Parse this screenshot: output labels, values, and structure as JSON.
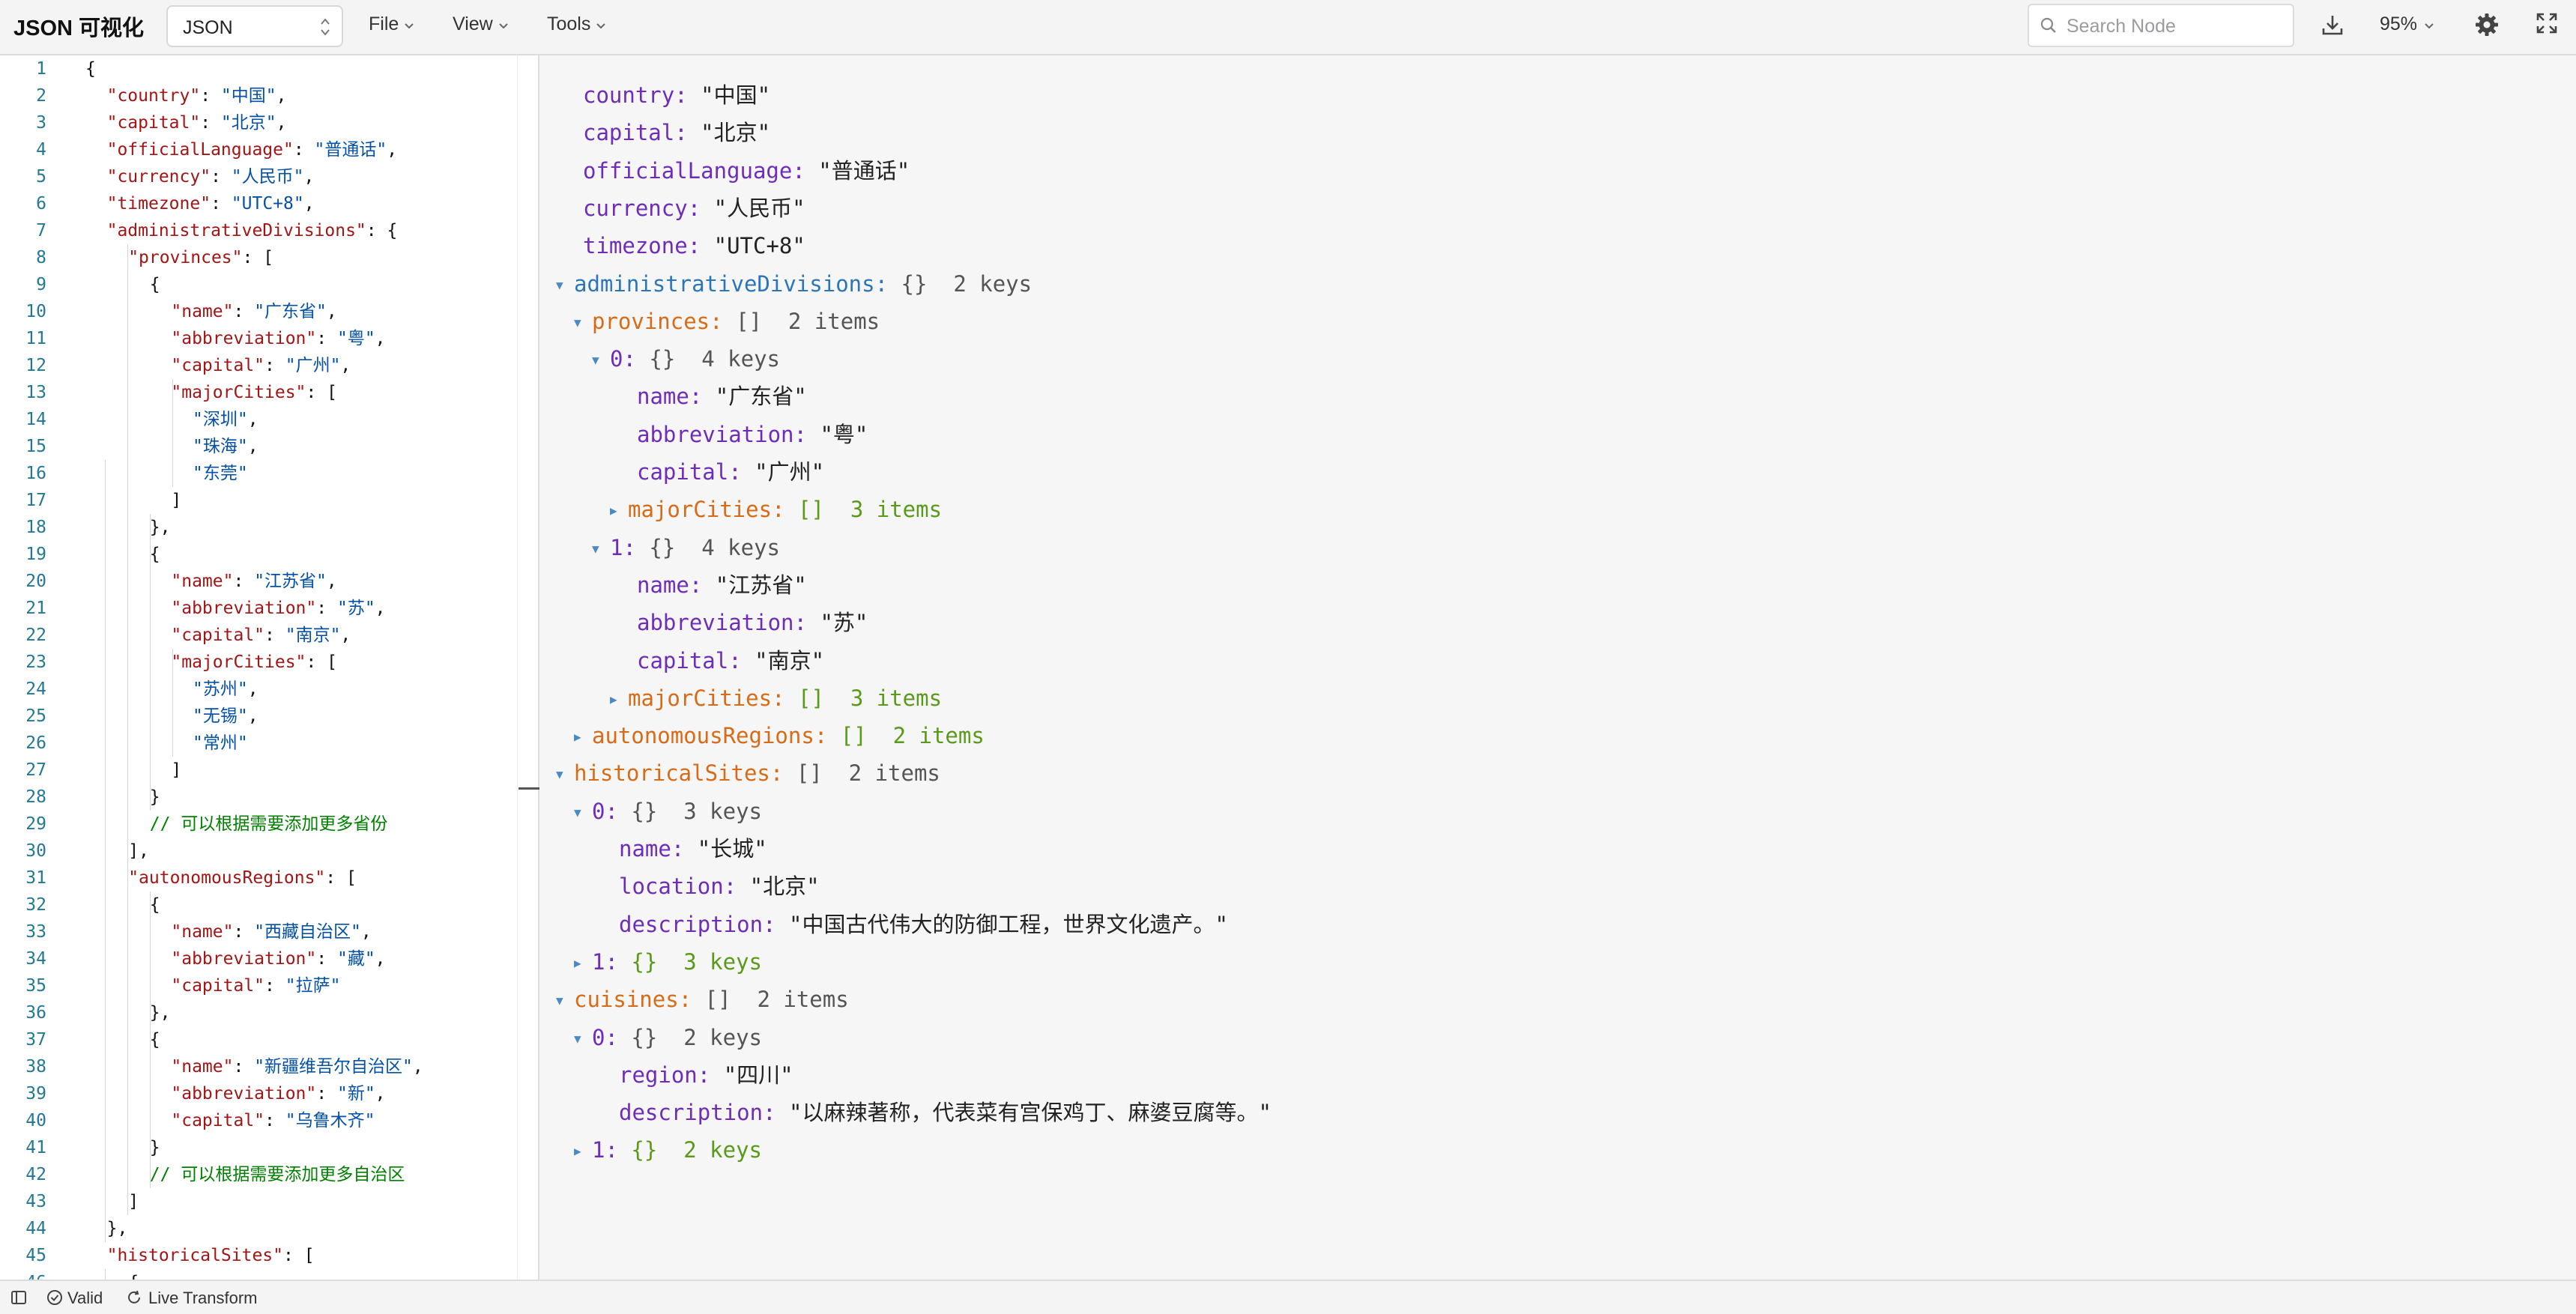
{
  "header": {
    "app_title": "JSON 可视化",
    "format_value": "JSON",
    "menus": [
      "File",
      "View",
      "Tools"
    ],
    "search_placeholder": "Search Node",
    "zoom_label": "95%"
  },
  "editor": {
    "lines": [
      [
        {
          "t": "p",
          "v": "{"
        }
      ],
      [
        {
          "t": "k",
          "v": "\"country\""
        },
        {
          "t": "p",
          "v": ": "
        },
        {
          "t": "s",
          "v": "\"中国\""
        },
        {
          "t": "p",
          "v": ","
        }
      ],
      [
        {
          "t": "k",
          "v": "\"capital\""
        },
        {
          "t": "p",
          "v": ": "
        },
        {
          "t": "s",
          "v": "\"北京\""
        },
        {
          "t": "p",
          "v": ","
        }
      ],
      [
        {
          "t": "k",
          "v": "\"officialLanguage\""
        },
        {
          "t": "p",
          "v": ": "
        },
        {
          "t": "s",
          "v": "\"普通话\""
        },
        {
          "t": "p",
          "v": ","
        }
      ],
      [
        {
          "t": "k",
          "v": "\"currency\""
        },
        {
          "t": "p",
          "v": ": "
        },
        {
          "t": "s",
          "v": "\"人民币\""
        },
        {
          "t": "p",
          "v": ","
        }
      ],
      [
        {
          "t": "k",
          "v": "\"timezone\""
        },
        {
          "t": "p",
          "v": ": "
        },
        {
          "t": "s",
          "v": "\"UTC+8\""
        },
        {
          "t": "p",
          "v": ","
        }
      ],
      [
        {
          "t": "k",
          "v": "\"administrativeDivisions\""
        },
        {
          "t": "p",
          "v": ": {"
        }
      ],
      [
        {
          "t": "k",
          "v": "\"provinces\""
        },
        {
          "t": "p",
          "v": ": ["
        }
      ],
      [
        {
          "t": "p",
          "v": "{"
        }
      ],
      [
        {
          "t": "k",
          "v": "\"name\""
        },
        {
          "t": "p",
          "v": ": "
        },
        {
          "t": "s",
          "v": "\"广东省\""
        },
        {
          "t": "p",
          "v": ","
        }
      ],
      [
        {
          "t": "k",
          "v": "\"abbreviation\""
        },
        {
          "t": "p",
          "v": ": "
        },
        {
          "t": "s",
          "v": "\"粤\""
        },
        {
          "t": "p",
          "v": ","
        }
      ],
      [
        {
          "t": "k",
          "v": "\"capital\""
        },
        {
          "t": "p",
          "v": ": "
        },
        {
          "t": "s",
          "v": "\"广州\""
        },
        {
          "t": "p",
          "v": ","
        }
      ],
      [
        {
          "t": "k",
          "v": "\"majorCities\""
        },
        {
          "t": "p",
          "v": ": ["
        }
      ],
      [
        {
          "t": "s",
          "v": "\"深圳\""
        },
        {
          "t": "p",
          "v": ","
        }
      ],
      [
        {
          "t": "s",
          "v": "\"珠海\""
        },
        {
          "t": "p",
          "v": ","
        }
      ],
      [
        {
          "t": "s",
          "v": "\"东莞\""
        }
      ],
      [
        {
          "t": "p",
          "v": "]"
        }
      ],
      [
        {
          "t": "p",
          "v": "},"
        }
      ],
      [
        {
          "t": "p",
          "v": "{"
        }
      ],
      [
        {
          "t": "k",
          "v": "\"name\""
        },
        {
          "t": "p",
          "v": ": "
        },
        {
          "t": "s",
          "v": "\"江苏省\""
        },
        {
          "t": "p",
          "v": ","
        }
      ],
      [
        {
          "t": "k",
          "v": "\"abbreviation\""
        },
        {
          "t": "p",
          "v": ": "
        },
        {
          "t": "s",
          "v": "\"苏\""
        },
        {
          "t": "p",
          "v": ","
        }
      ],
      [
        {
          "t": "k",
          "v": "\"capital\""
        },
        {
          "t": "p",
          "v": ": "
        },
        {
          "t": "s",
          "v": "\"南京\""
        },
        {
          "t": "p",
          "v": ","
        }
      ],
      [
        {
          "t": "k",
          "v": "\"majorCities\""
        },
        {
          "t": "p",
          "v": ": ["
        }
      ],
      [
        {
          "t": "s",
          "v": "\"苏州\""
        },
        {
          "t": "p",
          "v": ","
        }
      ],
      [
        {
          "t": "s",
          "v": "\"无锡\""
        },
        {
          "t": "p",
          "v": ","
        }
      ],
      [
        {
          "t": "s",
          "v": "\"常州\""
        }
      ],
      [
        {
          "t": "p",
          "v": "]"
        }
      ],
      [
        {
          "t": "p",
          "v": "}"
        }
      ],
      [
        {
          "t": "c",
          "v": "// 可以根据需要添加更多省份"
        }
      ],
      [
        {
          "t": "p",
          "v": "],"
        }
      ],
      [
        {
          "t": "k",
          "v": "\"autonomousRegions\""
        },
        {
          "t": "p",
          "v": ": ["
        }
      ],
      [
        {
          "t": "p",
          "v": "{"
        }
      ],
      [
        {
          "t": "k",
          "v": "\"name\""
        },
        {
          "t": "p",
          "v": ": "
        },
        {
          "t": "s",
          "v": "\"西藏自治区\""
        },
        {
          "t": "p",
          "v": ","
        }
      ],
      [
        {
          "t": "k",
          "v": "\"abbreviation\""
        },
        {
          "t": "p",
          "v": ": "
        },
        {
          "t": "s",
          "v": "\"藏\""
        },
        {
          "t": "p",
          "v": ","
        }
      ],
      [
        {
          "t": "k",
          "v": "\"capital\""
        },
        {
          "t": "p",
          "v": ": "
        },
        {
          "t": "s",
          "v": "\"拉萨\""
        }
      ],
      [
        {
          "t": "p",
          "v": "},"
        }
      ],
      [
        {
          "t": "p",
          "v": "{"
        }
      ],
      [
        {
          "t": "k",
          "v": "\"name\""
        },
        {
          "t": "p",
          "v": ": "
        },
        {
          "t": "s",
          "v": "\"新疆维吾尔自治区\""
        },
        {
          "t": "p",
          "v": ","
        }
      ],
      [
        {
          "t": "k",
          "v": "\"abbreviation\""
        },
        {
          "t": "p",
          "v": ": "
        },
        {
          "t": "s",
          "v": "\"新\""
        },
        {
          "t": "p",
          "v": ","
        }
      ],
      [
        {
          "t": "k",
          "v": "\"capital\""
        },
        {
          "t": "p",
          "v": ": "
        },
        {
          "t": "s",
          "v": "\"乌鲁木齐\""
        }
      ],
      [
        {
          "t": "p",
          "v": "}"
        }
      ],
      [
        {
          "t": "c",
          "v": "// 可以根据需要添加更多自治区"
        }
      ],
      [
        {
          "t": "p",
          "v": "]"
        }
      ],
      [
        {
          "t": "p",
          "v": "},"
        }
      ],
      [
        {
          "t": "k",
          "v": "\"historicalSites\""
        },
        {
          "t": "p",
          "v": ": ["
        }
      ],
      [
        {
          "t": "p",
          "v": "{"
        }
      ]
    ]
  },
  "tree": {
    "nodes": [
      {
        "key": "country",
        "value": "\"中国\""
      },
      {
        "key": "capital",
        "value": "\"北京\""
      },
      {
        "key": "officialLanguage",
        "value": "\"普通话\""
      },
      {
        "key": "currency",
        "value": "\"人民币\""
      },
      {
        "key": "timezone",
        "value": "\"UTC+8\""
      },
      {
        "key": "administrativeDivisions",
        "toggle": "expanded",
        "bracket": "{}",
        "meta": "2 keys"
      },
      {
        "key": "provinces",
        "toggle": "expanded",
        "bracket": "[]",
        "meta": "2 items"
      },
      {
        "key": "0",
        "toggle": "expanded",
        "bracket": "{}",
        "meta": "4 keys"
      },
      {
        "key": "name",
        "value": "\"广东省\""
      },
      {
        "key": "abbreviation",
        "value": "\"粤\""
      },
      {
        "key": "capital",
        "value": "\"广州\""
      },
      {
        "key": "majorCities",
        "toggle": "collapsed",
        "bracket": "[]",
        "meta": "3 items"
      },
      {
        "key": "1",
        "toggle": "expanded",
        "bracket": "{}",
        "meta": "4 keys"
      },
      {
        "key": "name",
        "value": "\"江苏省\""
      },
      {
        "key": "abbreviation",
        "value": "\"苏\""
      },
      {
        "key": "capital",
        "value": "\"南京\""
      },
      {
        "key": "majorCities",
        "toggle": "collapsed",
        "bracket": "[]",
        "meta": "3 items"
      },
      {
        "key": "autonomousRegions",
        "toggle": "collapsed",
        "bracket": "[]",
        "meta": "2 items"
      },
      {
        "key": "historicalSites",
        "toggle": "expanded",
        "bracket": "[]",
        "meta": "2 items"
      },
      {
        "key": "0",
        "toggle": "expanded",
        "bracket": "{}",
        "meta": "3 keys"
      },
      {
        "key": "name",
        "value": "\"长城\""
      },
      {
        "key": "location",
        "value": "\"北京\""
      },
      {
        "key": "description",
        "value": "\"中国古代伟大的防御工程，世界文化遗产。\""
      },
      {
        "key": "1",
        "toggle": "collapsed",
        "bracket": "{}",
        "meta": "3 keys"
      },
      {
        "key": "cuisines",
        "toggle": "expanded",
        "bracket": "[]",
        "meta": "2 items"
      },
      {
        "key": "0",
        "toggle": "expanded",
        "bracket": "{}",
        "meta": "2 keys"
      },
      {
        "key": "region",
        "value": "\"四川\""
      },
      {
        "key": "description",
        "value": "\"以麻辣著称，代表菜有宫保鸡丁、麻婆豆腐等。\""
      },
      {
        "key": "1",
        "toggle": "collapsed",
        "bracket": "{}",
        "meta": "2 keys"
      }
    ]
  },
  "footer": {
    "valid_label": "Valid",
    "live_transform_label": "Live Transform"
  },
  "colors": {
    "json_key": "#a31515",
    "json_string": "#0451a5",
    "json_comment": "#008000",
    "line_number": "#237893",
    "tree_key": "#6e2db8",
    "tree_array_key": "#d76b16",
    "tree_object_key": "#2c76b8",
    "tree_meta_collapsed": "#5a9a1a"
  },
  "icons": [
    "up-down-arrows-icon",
    "chevron-down-icon",
    "search-icon",
    "download-icon",
    "gear-icon",
    "fullscreen-icon",
    "sidebar-toggle-icon",
    "check-circle-icon",
    "refresh-icon"
  ]
}
